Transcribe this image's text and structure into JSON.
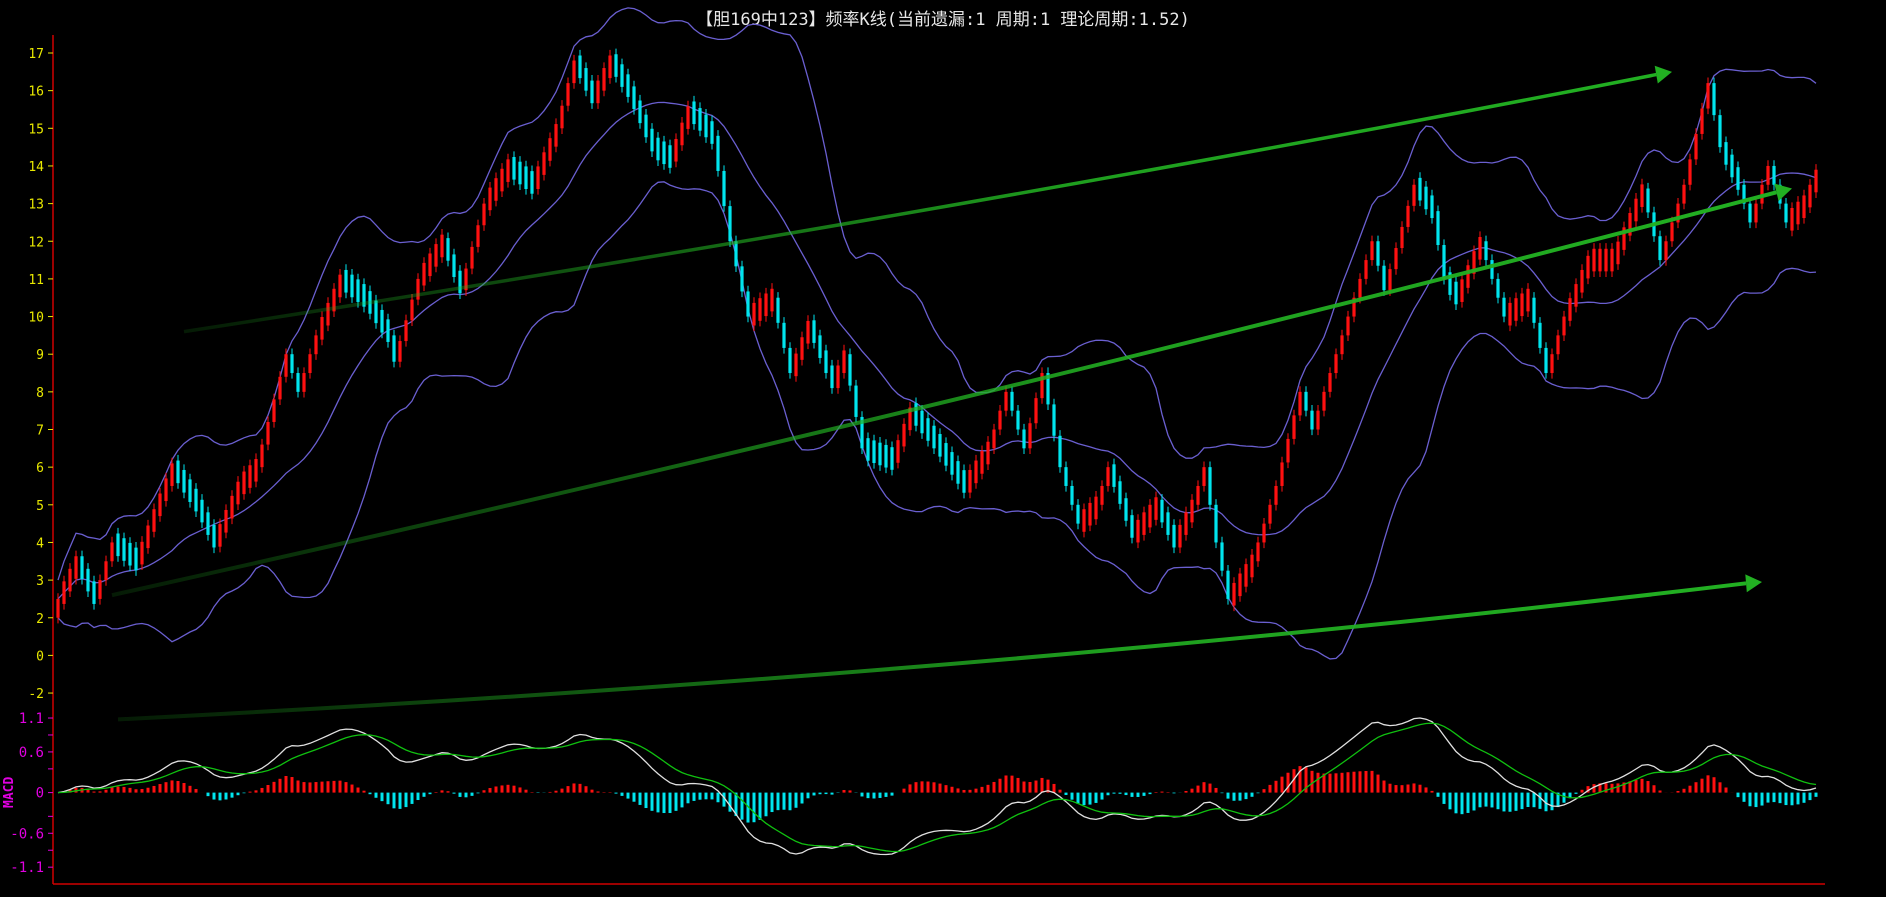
{
  "title": "【胆169中123】频率K线(当前遗漏:1 周期:1 理论周期:1.52)",
  "colors": {
    "up": "#ff1010",
    "down": "#00e5ee",
    "band": "#6a5fd0",
    "axis": "#d00000",
    "arrow": "#22b022",
    "dif": "#e0e0e0",
    "dea": "#10c010",
    "ylabel": "#e8e800",
    "macdlabel": "#e000e0"
  },
  "chart_data": [
    {
      "type": "candlestick",
      "title": "【胆169中123】频率K线(当前遗漏:1 周期:1 理论周期:1.52)",
      "y_ticks": [
        "17",
        "16",
        "15",
        "14",
        "13",
        "12",
        "11",
        "10",
        "9",
        "8",
        "7",
        "6",
        "5",
        "4",
        "3",
        "2",
        "0",
        "-2"
      ],
      "ylim": [
        -2,
        17
      ],
      "candle_count": 294,
      "close_keypoints": [
        [
          0,
          2.5
        ],
        [
          3,
          3.5
        ],
        [
          6,
          2.5
        ],
        [
          9,
          4
        ],
        [
          13,
          3.5
        ],
        [
          16,
          4.8
        ],
        [
          19,
          6
        ],
        [
          23,
          5
        ],
        [
          26,
          4
        ],
        [
          30,
          5.5
        ],
        [
          33,
          6
        ],
        [
          38,
          9
        ],
        [
          40,
          8
        ],
        [
          43,
          9.5
        ],
        [
          47,
          11
        ],
        [
          51,
          10.5
        ],
        [
          55,
          9.5
        ],
        [
          56,
          8.8
        ],
        [
          60,
          11
        ],
        [
          64,
          12
        ],
        [
          67,
          10.7
        ],
        [
          71,
          13
        ],
        [
          75,
          14
        ],
        [
          79,
          13.5
        ],
        [
          83,
          15
        ],
        [
          86,
          16.8
        ],
        [
          89,
          15.8
        ],
        [
          92,
          16.8
        ],
        [
          95,
          16
        ],
        [
          99,
          14.5
        ],
        [
          102,
          14.2
        ],
        [
          105,
          15.5
        ],
        [
          109,
          14.8
        ],
        [
          112,
          12
        ],
        [
          115,
          10
        ],
        [
          119,
          10.5
        ],
        [
          122,
          8.5
        ],
        [
          125,
          9.8
        ],
        [
          129,
          8.2
        ],
        [
          131,
          9
        ],
        [
          134,
          6.5
        ],
        [
          139,
          6.2
        ],
        [
          142,
          7.5
        ],
        [
          146,
          6.7
        ],
        [
          151,
          5.5
        ],
        [
          155,
          6.5
        ],
        [
          158,
          8
        ],
        [
          161,
          6.5
        ],
        [
          164,
          8.5
        ],
        [
          167,
          6
        ],
        [
          170,
          4.5
        ],
        [
          173,
          5
        ],
        [
          175,
          6
        ],
        [
          179,
          4.2
        ],
        [
          183,
          5
        ],
        [
          186,
          4
        ],
        [
          189,
          5
        ],
        [
          191,
          6
        ],
        [
          193,
          4
        ],
        [
          195,
          2.5
        ],
        [
          199,
          3.5
        ],
        [
          203,
          5.5
        ],
        [
          207,
          8
        ],
        [
          209,
          7
        ],
        [
          213,
          9
        ],
        [
          219,
          12
        ],
        [
          221,
          10.7
        ],
        [
          226,
          13.5
        ],
        [
          229,
          12.8
        ],
        [
          231,
          11
        ],
        [
          233,
          10.5
        ],
        [
          237,
          12
        ],
        [
          241,
          10
        ],
        [
          245,
          10.5
        ],
        [
          248,
          8.5
        ],
        [
          251,
          10
        ],
        [
          255,
          11.5
        ],
        [
          259,
          11.5
        ],
        [
          264,
          13.4
        ],
        [
          267,
          11.5
        ],
        [
          271,
          13.5
        ],
        [
          275,
          16.2
        ],
        [
          277,
          14.5
        ],
        [
          280,
          13.5
        ],
        [
          282,
          12.5
        ],
        [
          285,
          14
        ],
        [
          288,
          12.5
        ],
        [
          291,
          13
        ],
        [
          293,
          13.8
        ]
      ],
      "indicators": [
        "Bollinger(20,2)"
      ],
      "trend_arrows": [
        {
          "from": [
            21,
            9.6
          ],
          "to": [
            269,
            16.5
          ]
        },
        {
          "from": [
            9,
            2.6
          ],
          "to": [
            289,
            13.4
          ]
        },
        {
          "from": [
            10,
            -0.7
          ],
          "to": [
            284,
            2.95
          ]
        }
      ]
    },
    {
      "type": "macd",
      "label": "MACD",
      "y_ticks": [
        {
          "v": 1.1,
          "t": "1.1"
        },
        {
          "v": 0.6,
          "t": "0.6"
        },
        {
          "v": 0,
          "t": "0"
        },
        {
          "v": -0.6,
          "t": "-0.6"
        },
        {
          "v": -1.1,
          "t": "-1.1"
        }
      ],
      "ylim": [
        -1.3,
        1.2
      ],
      "series": [
        "DIF",
        "DEA",
        "MACD histogram"
      ]
    }
  ]
}
